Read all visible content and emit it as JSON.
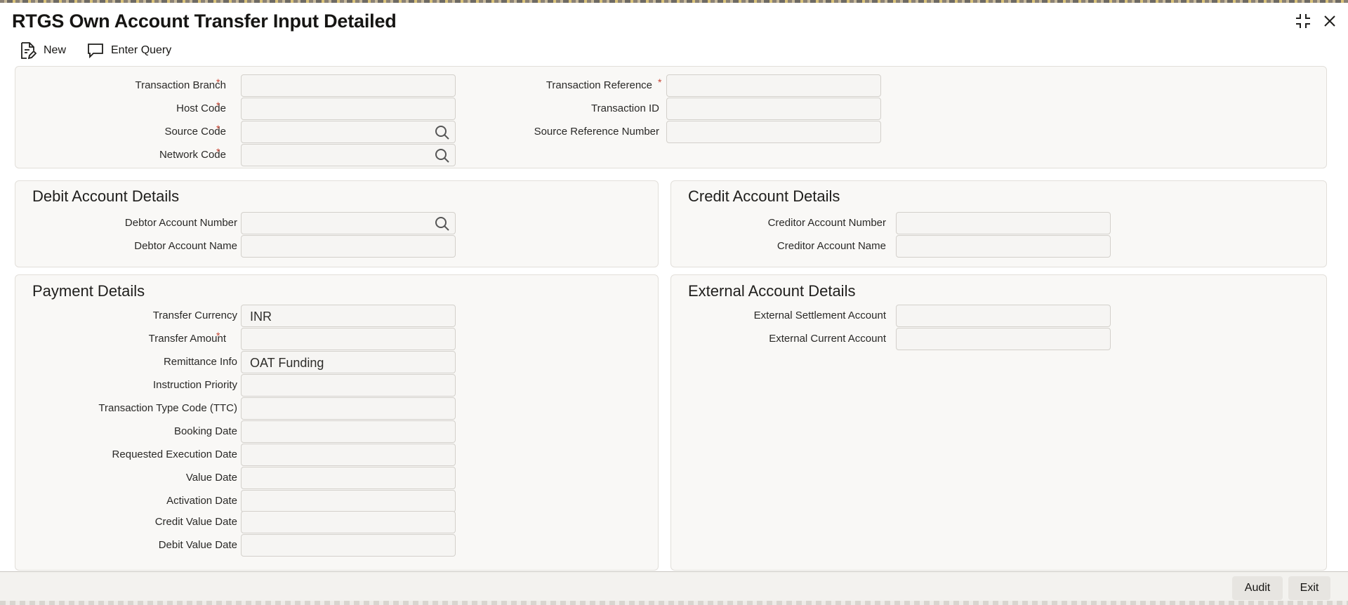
{
  "window": {
    "title": "RTGS Own Account Transfer Input Detailed"
  },
  "toolbar": {
    "new_label": "New",
    "enter_query_label": "Enter Query"
  },
  "header_fields": {
    "transaction_branch": {
      "label": "Transaction Branch",
      "value": ""
    },
    "host_code": {
      "label": "Host Code",
      "value": ""
    },
    "source_code": {
      "label": "Source Code",
      "value": ""
    },
    "network_code": {
      "label": "Network Code",
      "value": ""
    },
    "transaction_reference": {
      "label": "Transaction Reference",
      "value": ""
    },
    "transaction_id": {
      "label": "Transaction ID",
      "value": ""
    },
    "source_reference_number": {
      "label": "Source Reference Number",
      "value": ""
    }
  },
  "debit": {
    "title": "Debit Account Details",
    "debtor_account_number": {
      "label": "Debtor Account Number",
      "value": ""
    },
    "debtor_account_name": {
      "label": "Debtor Account Name",
      "value": ""
    }
  },
  "credit": {
    "title": "Credit Account Details",
    "creditor_account_number": {
      "label": "Creditor Account Number",
      "value": ""
    },
    "creditor_account_name": {
      "label": "Creditor Account Name",
      "value": ""
    }
  },
  "payment": {
    "title": "Payment Details",
    "transfer_currency": {
      "label": "Transfer Currency",
      "value": "INR"
    },
    "transfer_amount": {
      "label": "Transfer Amount",
      "value": ""
    },
    "remittance_info": {
      "label": "Remittance Info",
      "value": "OAT Funding"
    },
    "instruction_priority": {
      "label": "Instruction Priority",
      "value": ""
    },
    "ttc": {
      "label": "Transaction Type Code (TTC)",
      "value": ""
    },
    "booking_date": {
      "label": "Booking Date",
      "value": ""
    },
    "requested_execution_date": {
      "label": "Requested Execution Date",
      "value": ""
    },
    "value_date": {
      "label": "Value Date",
      "value": ""
    },
    "activation_date": {
      "label": "Activation Date",
      "value": ""
    },
    "credit_value_date": {
      "label": "Credit Value Date",
      "value": ""
    },
    "debit_value_date": {
      "label": "Debit Value Date",
      "value": ""
    }
  },
  "external": {
    "title": "External Account Details",
    "external_settlement_account": {
      "label": "External Settlement Account",
      "value": ""
    },
    "external_current_account": {
      "label": "External Current Account",
      "value": ""
    }
  },
  "footer": {
    "audit_label": "Audit",
    "exit_label": "Exit"
  },
  "required_marker": "*",
  "colors": {
    "required": "#c74634",
    "panel_bg": "#f9f8f6",
    "field_bg": "#f6f5f3"
  },
  "icons": [
    "new-document-icon",
    "enter-query-icon",
    "minimize-icon",
    "close-icon",
    "search-icon"
  ]
}
